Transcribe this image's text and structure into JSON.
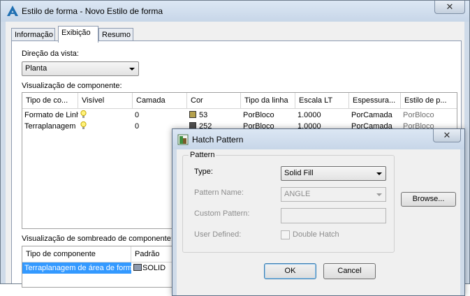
{
  "main_window": {
    "title": "Estilo de forma - Novo Estilo de forma",
    "close_glyph": "✕",
    "tabs": [
      "Informação",
      "Exibição",
      "Resumo"
    ],
    "active_tab": "Exibição",
    "view_direction": {
      "label": "Direção da vista:",
      "value": "Planta"
    },
    "component_display": {
      "label": "Visualização de componente:",
      "columns": [
        "Tipo de co...",
        "Visível",
        "Camada",
        "Cor",
        "Tipo da linha",
        "Escala LT",
        "Espessura...",
        "Estilo de p..."
      ],
      "rows": [
        {
          "component": "Formato de Linha",
          "visible_icon": "lightbulb-on-icon",
          "layer": "0",
          "color_swatch": "#b5a14d",
          "color": "53",
          "linetype": "PorBloco",
          "lt_scale": "1.0000",
          "lineweight": "PorCamada",
          "plot_style": "PorBloco"
        },
        {
          "component": "Terraplanagem",
          "visible_icon": "lightbulb-on-icon",
          "layer": "0",
          "color_swatch": "#4f4f4f",
          "color": "252",
          "linetype": "PorBloco",
          "lt_scale": "1.0000",
          "lineweight": "PorCamada",
          "plot_style": "PorBloco"
        }
      ]
    },
    "hatch_display": {
      "label": "Visualização de sombreado de componente:",
      "columns": [
        "Tipo de componente",
        "Padrão"
      ],
      "rows": [
        {
          "component": "Terraplanagem de área de forma",
          "pattern_swatch": "#8e9aae",
          "pattern": "SOLID",
          "selected": true
        }
      ]
    }
  },
  "hatch_dialog": {
    "title": "Hatch Pattern",
    "close_glyph": "✕",
    "group_label": "Pattern",
    "type": {
      "label": "Type:",
      "value": "Solid Fill"
    },
    "pattern_name": {
      "label": "Pattern Name:",
      "value": "ANGLE"
    },
    "custom_pattern": {
      "label": "Custom Pattern:",
      "value": ""
    },
    "user_defined": {
      "label": "User Defined:",
      "checkbox_label": "Double Hatch",
      "checked": false
    },
    "browse_label": "Browse...",
    "ok_label": "OK",
    "cancel_label": "Cancel"
  },
  "colors": {
    "accent": "#3399ff",
    "frame": "#cfdbe9"
  }
}
